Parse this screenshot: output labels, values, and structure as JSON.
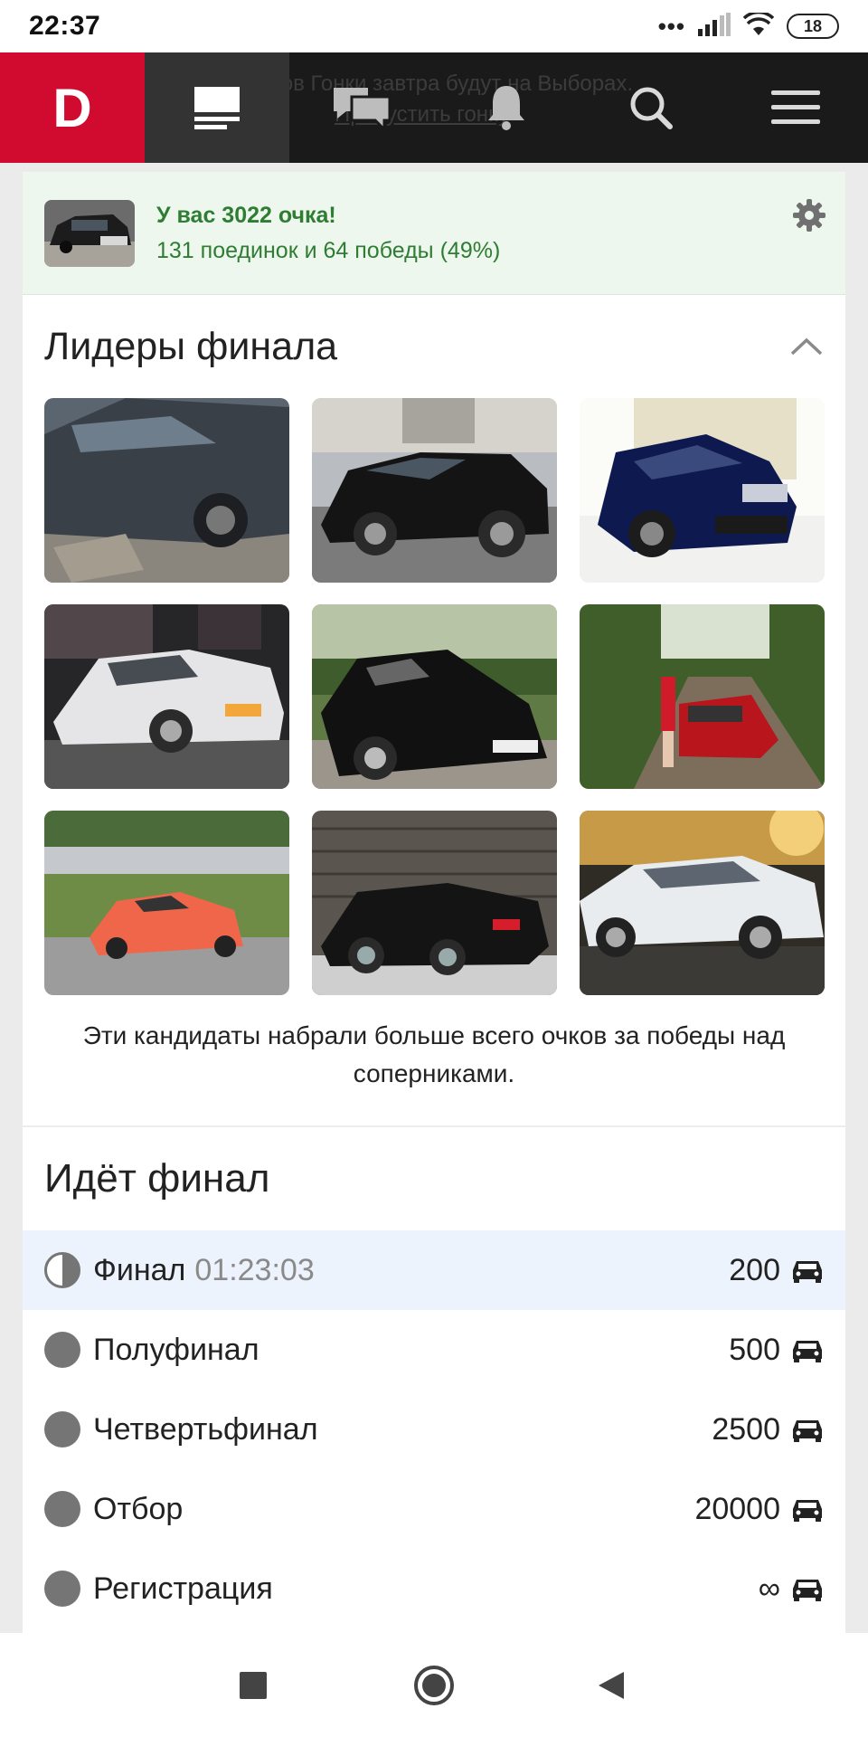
{
  "status_bar": {
    "time": "22:37",
    "dots": "•••",
    "battery": "18"
  },
  "header": {
    "logo": "D",
    "ticker_line1": "тов Гонки завтра будут на Выборах.",
    "ticker_line2": "Пропустить гонку"
  },
  "score": {
    "title": "У вас 3022 очка!",
    "subtitle": "131 поединок и 64 победы (49%)"
  },
  "leaders": {
    "title": "Лидеры финала",
    "caption": "Эти кандидаты набрали больше всего очков за победы над соперниками."
  },
  "final": {
    "title": "Идёт финал",
    "stages": [
      {
        "name": "Финал",
        "timer": "01:23:03",
        "count": "200",
        "state": "active"
      },
      {
        "name": "Полуфинал",
        "timer": "",
        "count": "500",
        "state": "done"
      },
      {
        "name": "Четвертьфинал",
        "timer": "",
        "count": "2500",
        "state": "done"
      },
      {
        "name": "Отбор",
        "timer": "",
        "count": "20000",
        "state": "done"
      },
      {
        "name": "Регистрация",
        "timer": "",
        "count": "∞",
        "state": "done"
      }
    ]
  },
  "colors": {
    "brand_red": "#d10a2f",
    "header_dark": "#1a1a1a",
    "score_green": "#2e7d32",
    "score_bg": "#eef7ee",
    "active_row_bg": "#edf3fc"
  },
  "icons": [
    "feed-icon",
    "chat-icon",
    "bell-icon",
    "search-icon",
    "menu-icon",
    "gear-icon",
    "chevron-up-icon",
    "car-icon",
    "stop-icon",
    "home-icon",
    "back-icon"
  ]
}
